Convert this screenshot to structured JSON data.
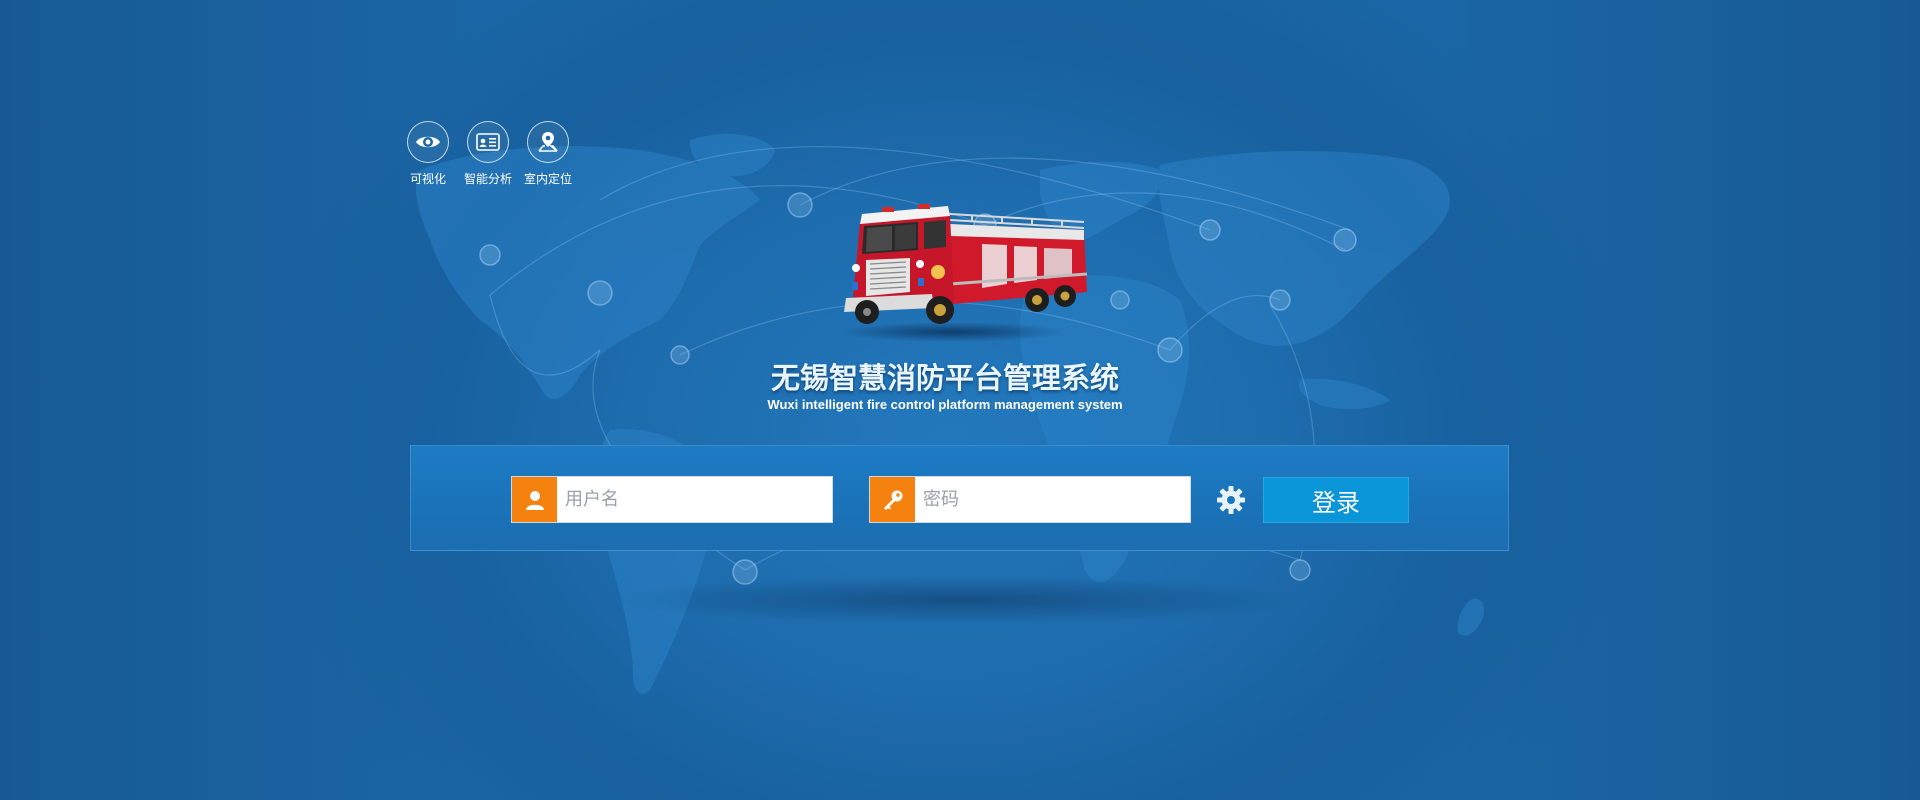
{
  "features": [
    {
      "label": "可视化",
      "icon": "eye-icon"
    },
    {
      "label": "智能分析",
      "icon": "id-card-icon"
    },
    {
      "label": "室内定位",
      "icon": "map-pin-icon"
    }
  ],
  "title": "无锡智慧消防平台管理系统",
  "subtitle": "Wuxi intelligent fire control platform management system",
  "login": {
    "username_placeholder": "用户名",
    "password_placeholder": "密码",
    "username_icon": "user-icon",
    "password_icon": "key-icon",
    "settings_icon": "gear-icon",
    "submit_label": "登录"
  },
  "colors": {
    "background": "#1b66a6",
    "field_icon_bg": "#f5820f",
    "button_bg": "#0b95d9",
    "truck_red": "#d0192b"
  },
  "images": {
    "hero": "fire-truck-illustration",
    "backdrop": "world-map-network"
  }
}
